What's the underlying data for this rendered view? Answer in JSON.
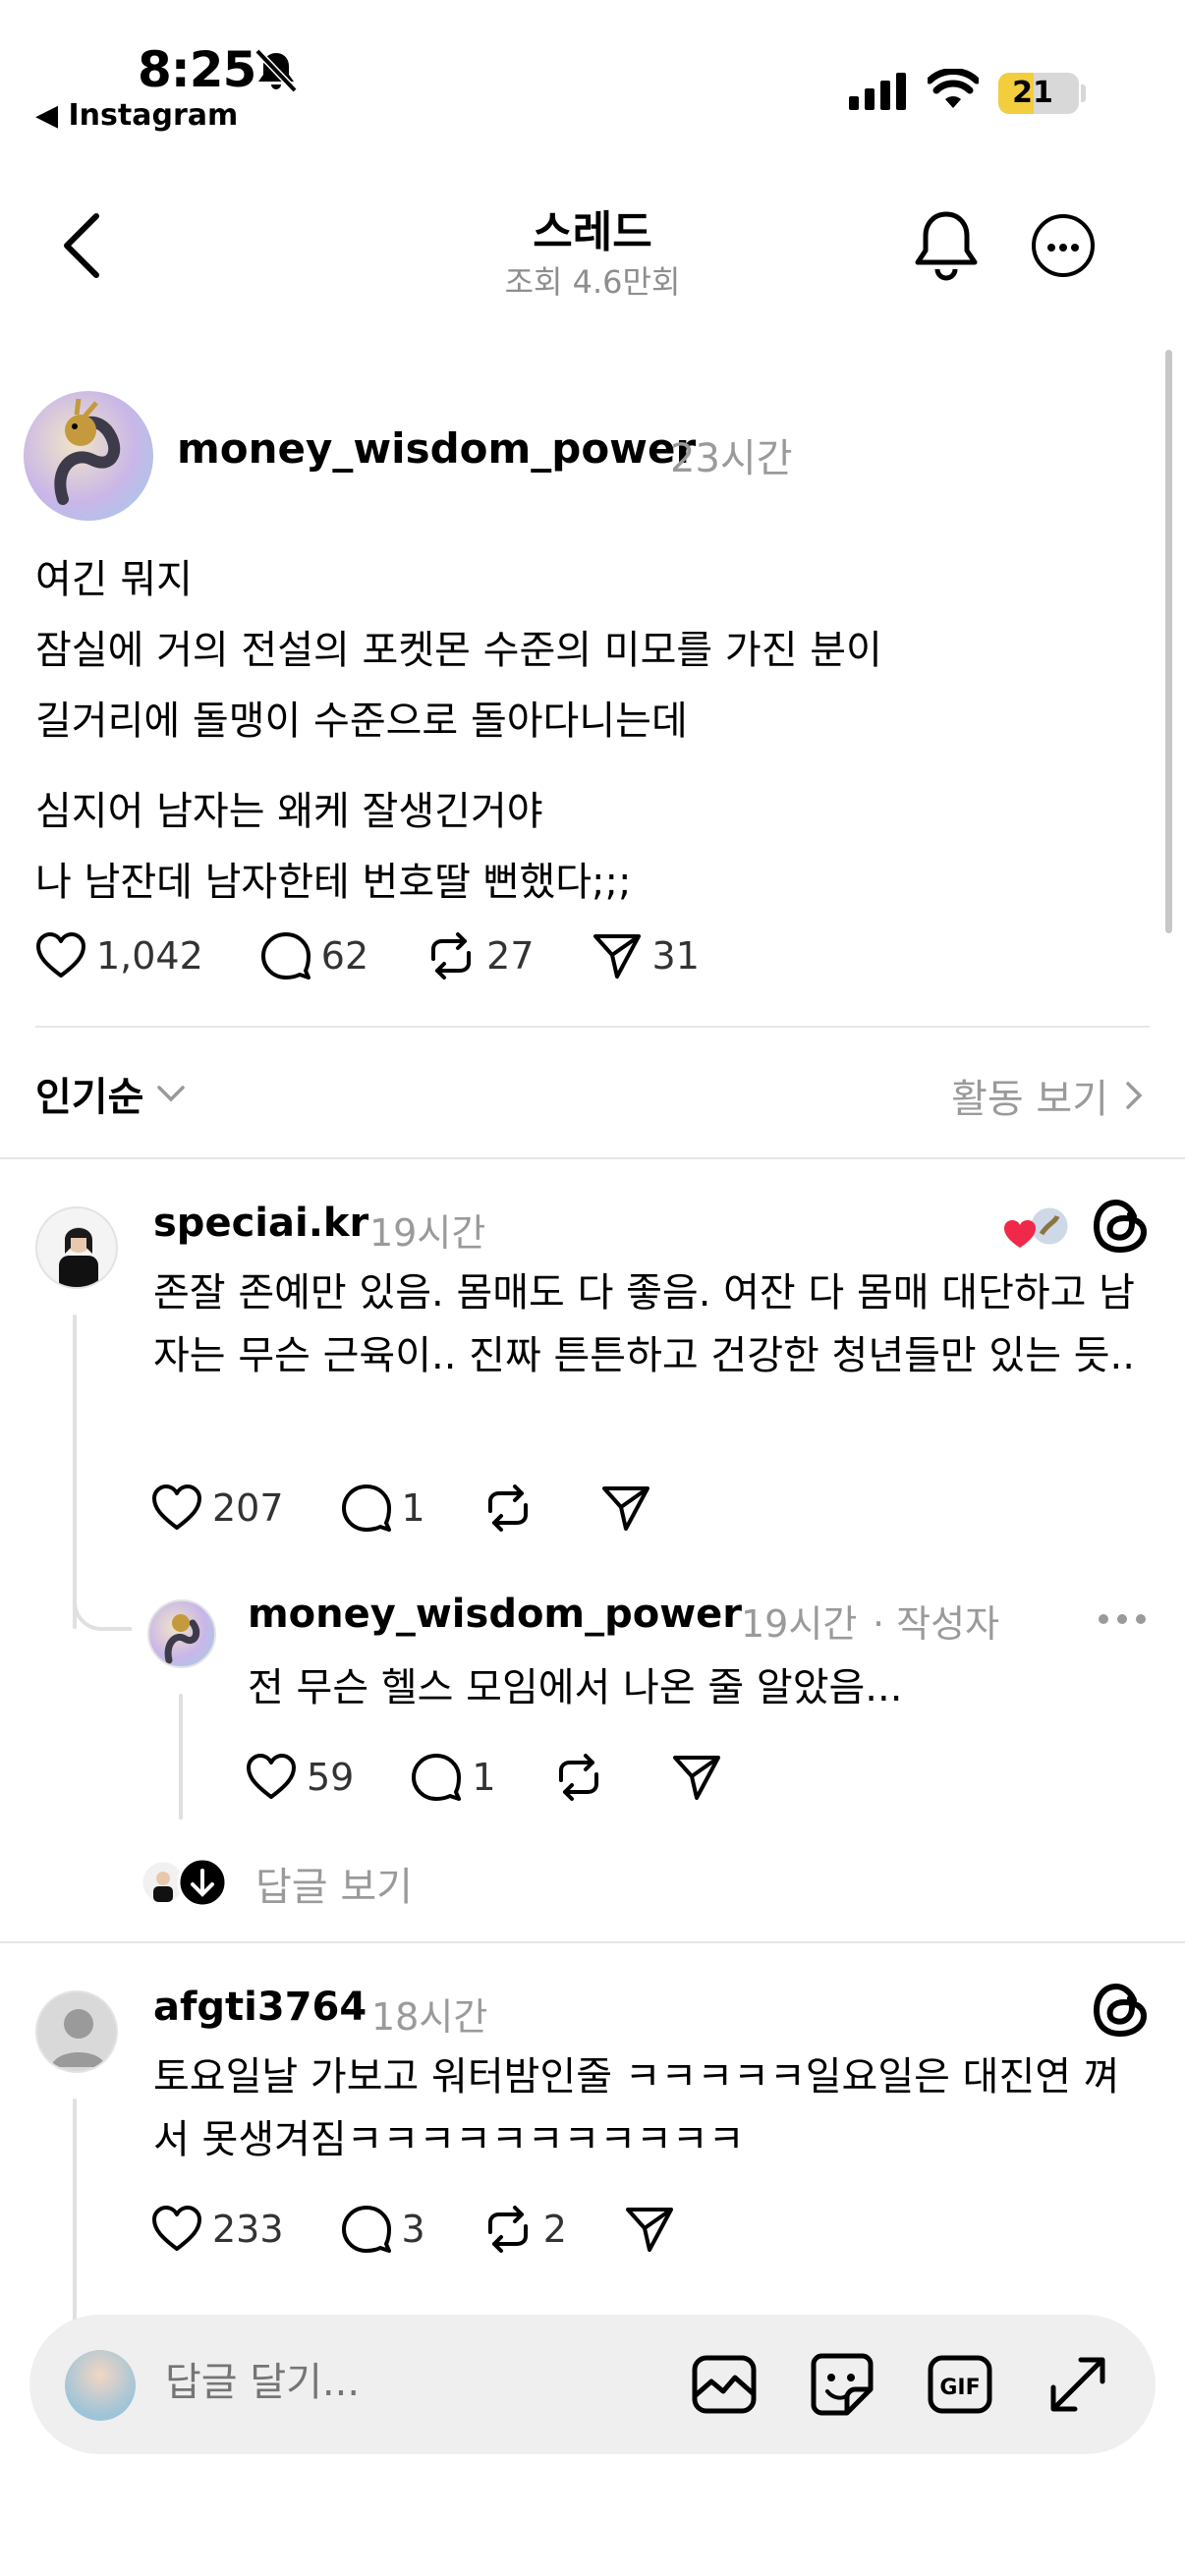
{
  "status_bar": {
    "time": "8:25",
    "back_app": "◀ Instagram",
    "battery": "21",
    "icons": [
      "bell-slash-icon",
      "signal-icon",
      "wifi-icon",
      "battery-icon"
    ]
  },
  "header": {
    "title": "스레드",
    "subtitle": "조회 4.6만회",
    "icons": [
      "back-chevron-icon",
      "bell-icon",
      "more-icon"
    ]
  },
  "post": {
    "username": "money_wisdom_power",
    "time": "23시간",
    "lines": [
      "여긴 뭐지",
      "잠실에 거의 전설의 포켓몬 수준의 미모를 가진 분이",
      "길거리에 돌맹이 수준으로 돌아다니는데",
      "심지어 남자는 왜케 잘생긴거야",
      "나 남잔데 남자한테 번호딸 뻔했다;;;"
    ],
    "likes": "1,042",
    "comments": "62",
    "reposts": "27",
    "shares": "31"
  },
  "sort": {
    "label": "인기순",
    "activity_label": "활동 보기"
  },
  "comments": [
    {
      "username": "speciai.kr",
      "time": "19시간",
      "text": "존잘 존예만 있음. 몸매도 다 좋음. 여잔 다 몸매 대단하고 남자는 무슨 근육이.. 진짜 튼튼하고 건강한 청년들만 있는 듯..",
      "likes": "207",
      "comments": "1",
      "reposts": "",
      "reply": {
        "username": "money_wisdom_power",
        "time": "19시간",
        "author_tag": "· 작성자",
        "text": "전 무슨 헬스 모임에서 나온 줄 알았음...",
        "likes": "59",
        "comments": "1"
      }
    },
    {
      "username": "afgti3764",
      "time": "18시간",
      "text": "토요일날 가보고 워터밤인줄 ㅋㅋㅋㅋㅋ일요일은 대진연 껴서 못생겨짐ㅋㅋㅋㅋㅋㅋㅋㅋㅋㅋㅋ",
      "likes": "233",
      "comments": "3",
      "reposts": "2"
    }
  ],
  "view_replies": "답글 보기",
  "composer": {
    "placeholder": "답글 달기...",
    "icons": [
      "image-icon",
      "sticker-icon",
      "gif-icon",
      "expand-icon"
    ]
  }
}
